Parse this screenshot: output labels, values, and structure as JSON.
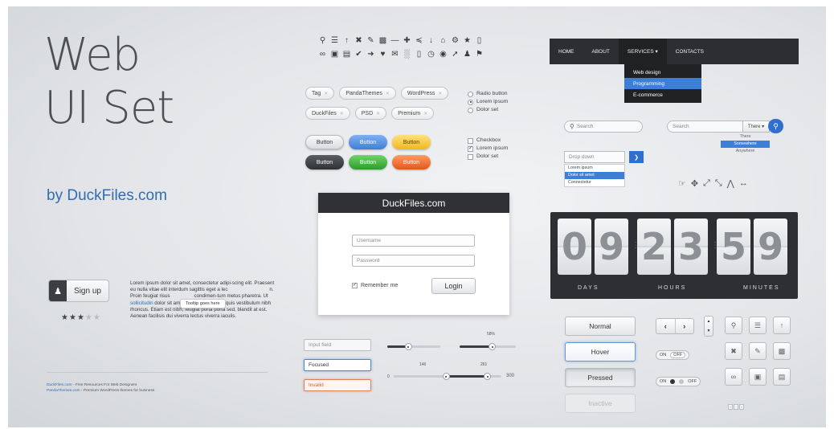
{
  "hero": {
    "line1": "Web",
    "line2": "UI Set",
    "byline": "by DuckFiles.com"
  },
  "signup": {
    "label": "Sign up",
    "icon": "user-icon"
  },
  "rating": {
    "value": 3,
    "max": 5
  },
  "lorem": {
    "part1": "Lorem ipsum dolor sit amet, consectetur adipi-scing elit. Praesent eu nulla vitae elit interdum sagittis eget a lec",
    "part2": "n. Proin feugiat risus",
    "part3": "condimen-tum metus pharetra. Ut ",
    "link": "sollicitudin",
    "part4": " dolor sit amet libero scelerisque quis vestibulum nibh rhoncus. Etiam est nibh, feugiat porta porta sed, blandit at est. Aenean facilisis dui viverra lectus viverra iaculis."
  },
  "tooltip": "Tooltip goes here",
  "footer": {
    "link1": "DuckFiles.com",
    "text1": " - Free Resources For Web Designers",
    "link2": "PandaThemes.com",
    "text2": " - Premium WordPress themes for business"
  },
  "icons_row1": [
    "search-icon",
    "list-icon",
    "upload-icon",
    "close-icon",
    "pencil-icon",
    "chat-icon",
    "minus-icon",
    "plus-icon",
    "filter-icon",
    "download-icon",
    "home-icon",
    "gear-icon",
    "star-icon",
    "folder-icon"
  ],
  "icons_row2": [
    "link-icon",
    "image-icon",
    "file-icon",
    "check-icon",
    "arrow-right-icon",
    "heart-icon",
    "mail-icon",
    "chart-icon",
    "phone-icon",
    "clock-icon",
    "globe-icon",
    "cursor-icon",
    "users-icon",
    "tag-icon"
  ],
  "tags": {
    "row1": [
      "Tag",
      "PandaThemes",
      "WordPress"
    ],
    "row2": [
      "DuckFiles",
      "PSD",
      "Premium"
    ]
  },
  "radios": [
    "Radio button",
    "Lorem ipsum",
    "Dolor set"
  ],
  "checkboxes": [
    "Checkbox",
    "Lorem ipsum",
    "Dolor set"
  ],
  "pills": {
    "light": "Button",
    "blue": "Button",
    "yellow": "Button",
    "dark": "Button",
    "green": "Button",
    "orange": "Button"
  },
  "login": {
    "title": "DuckFiles.com",
    "username_placeholder": "Username",
    "password_placeholder": "Password",
    "remember": "Remember me",
    "submit": "Login"
  },
  "inputs": {
    "normal": "Input field",
    "focused": "Focused",
    "invalid": "Invalid"
  },
  "sliders": {
    "s2_label": "58%",
    "range_min": "0",
    "range_max": "300",
    "range_low_label": "146",
    "range_high_label": "261",
    "s1_value": 0.4,
    "s2_value": 0.58,
    "range_low": 146,
    "range_high": 261
  },
  "nav": {
    "items": [
      "HOME",
      "ABOUT",
      "SERVICES",
      "CONTACTS"
    ],
    "services_caret": "▾",
    "dropdown": [
      "Web design",
      "Programming",
      "E-commerce"
    ]
  },
  "search": {
    "placeholder1": "Search",
    "placeholder2": "Search",
    "select_value": "There",
    "options": [
      "There",
      "Somewhere",
      "Anywhere"
    ]
  },
  "dropdown": {
    "placeholder": "Drop down",
    "options": [
      "Lorem ipsum",
      "Dolor sit amet",
      "Connectetur"
    ]
  },
  "countdown": {
    "digits": [
      "0",
      "9",
      "2",
      "3",
      "5",
      "9"
    ],
    "labels": [
      "DAYS",
      "HOURS",
      "MINUTES"
    ]
  },
  "states": {
    "normal": "Normal",
    "hover": "Hover",
    "pressed": "Pressed",
    "inactive": "Inactive"
  },
  "toggles": {
    "on": "ON",
    "off": "OFF"
  },
  "colors": {
    "accent": "#2f6fd0",
    "dark": "#2c2e31",
    "link": "#2f6db5"
  }
}
